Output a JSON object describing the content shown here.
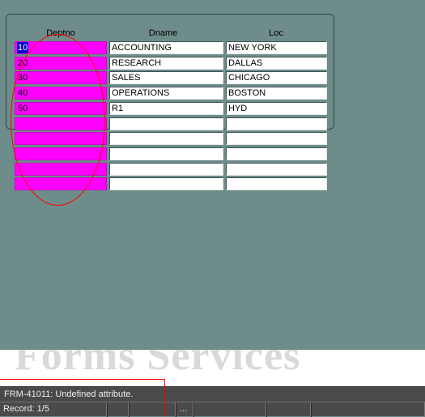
{
  "form": {
    "columns": [
      "Deptno",
      "Dname",
      "Loc"
    ],
    "rows": [
      {
        "deptno": "10",
        "dname": "ACCOUNTING",
        "loc": "NEW YORK"
      },
      {
        "deptno": "20",
        "dname": "RESEARCH",
        "loc": "DALLAS"
      },
      {
        "deptno": "30",
        "dname": "SALES",
        "loc": "CHICAGO"
      },
      {
        "deptno": "40",
        "dname": "OPERATIONS",
        "loc": "BOSTON"
      },
      {
        "deptno": "50",
        "dname": "R1",
        "loc": "HYD"
      },
      {
        "deptno": "",
        "dname": "",
        "loc": ""
      },
      {
        "deptno": "",
        "dname": "",
        "loc": ""
      },
      {
        "deptno": "",
        "dname": "",
        "loc": ""
      },
      {
        "deptno": "",
        "dname": "",
        "loc": ""
      },
      {
        "deptno": "",
        "dname": "",
        "loc": ""
      }
    ]
  },
  "banner": {
    "text": "Forms Services"
  },
  "message_bar": {
    "text": "FRM-41011: Undefined attribute."
  },
  "status_bar": {
    "record": "Record: 1/5",
    "indicator": "..."
  },
  "colors": {
    "canvas": "#6e8c8a",
    "deptno_field": "#ff00ff",
    "annotation": "#ff0000",
    "status_bar": "#4a4a4a"
  }
}
